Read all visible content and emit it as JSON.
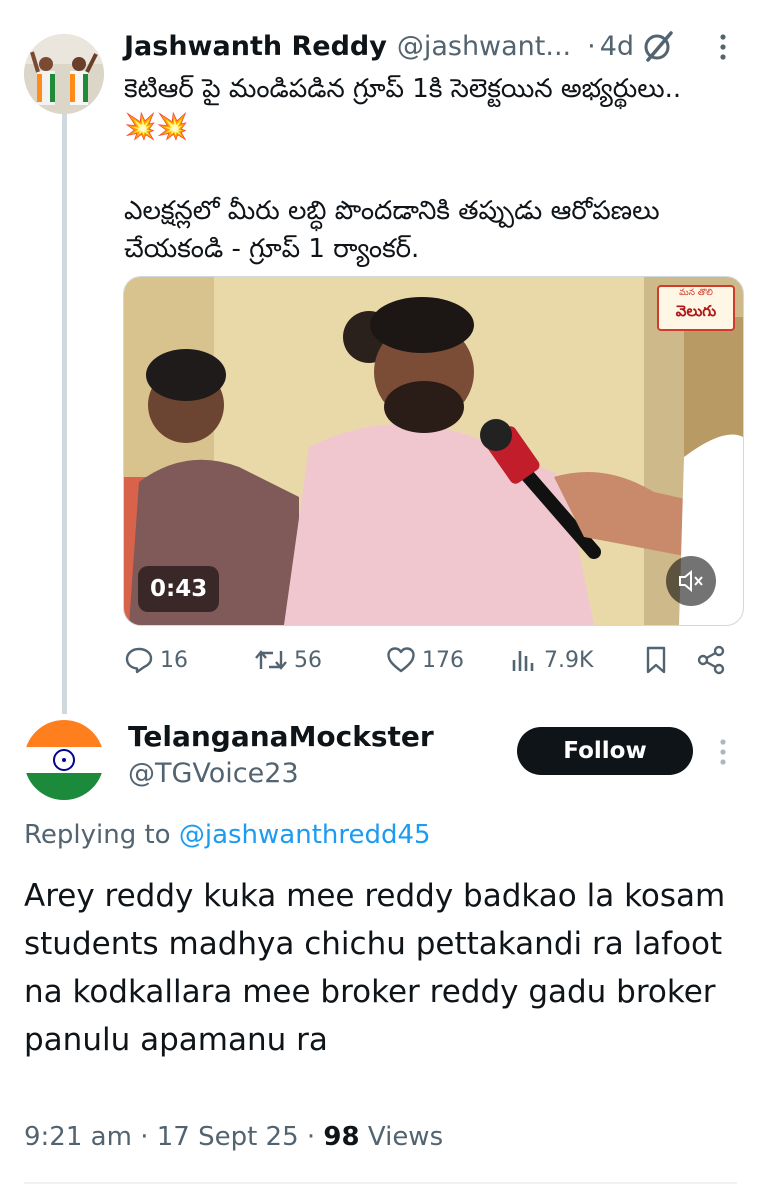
{
  "tweet": {
    "author_name": "Jashwanth Reddy",
    "author_handle": "@jashwant...",
    "separator": "·",
    "age": "4d",
    "text_line1": "కెటిఆర్ పై మండిపడిన గ్రూప్ 1కి సెలెక్టయిన అభ్యర్థులు..",
    "emojis": "💥💥",
    "text_para2": "ఎలక్షన్లలో మీరు లబ్ధి పొందడానికి తప్పుడు ఆరోపణలు చేయకండి - గ్రూప్ 1 ర్యాంకర్.",
    "video": {
      "duration": "0:43",
      "watermark": "వెలుగు",
      "watermark_small": "మన తొలి"
    },
    "actions": {
      "replies": "16",
      "reposts": "56",
      "likes": "176",
      "views": "7.9K"
    }
  },
  "reply": {
    "author_name": "TelanganaMockster",
    "author_handle": "@TGVoice23",
    "follow_label": "Follow",
    "replying_prefix": "Replying to",
    "replying_mention": "@jashwanthredd45",
    "text": "Arey reddy kuka mee reddy badkao la kosam students madhya chichu pettakandi ra lafoot na kodkallara mee broker reddy gadu broker panulu apamanu ra",
    "time": "9:21 am",
    "date": "17 Sept 25",
    "dot": "·",
    "views_count": "98",
    "views_label": "Views"
  },
  "colors": {
    "text_primary": "#0f1419",
    "text_secondary": "#536471",
    "link": "#1d9bf0",
    "thread_line": "#cfd9de",
    "follow_bg": "#0f1419"
  },
  "icons": [
    "grok-icon",
    "more-icon",
    "reply-icon",
    "repost-icon",
    "like-icon",
    "views-icon",
    "bookmark-icon",
    "share-icon",
    "mute-icon"
  ]
}
